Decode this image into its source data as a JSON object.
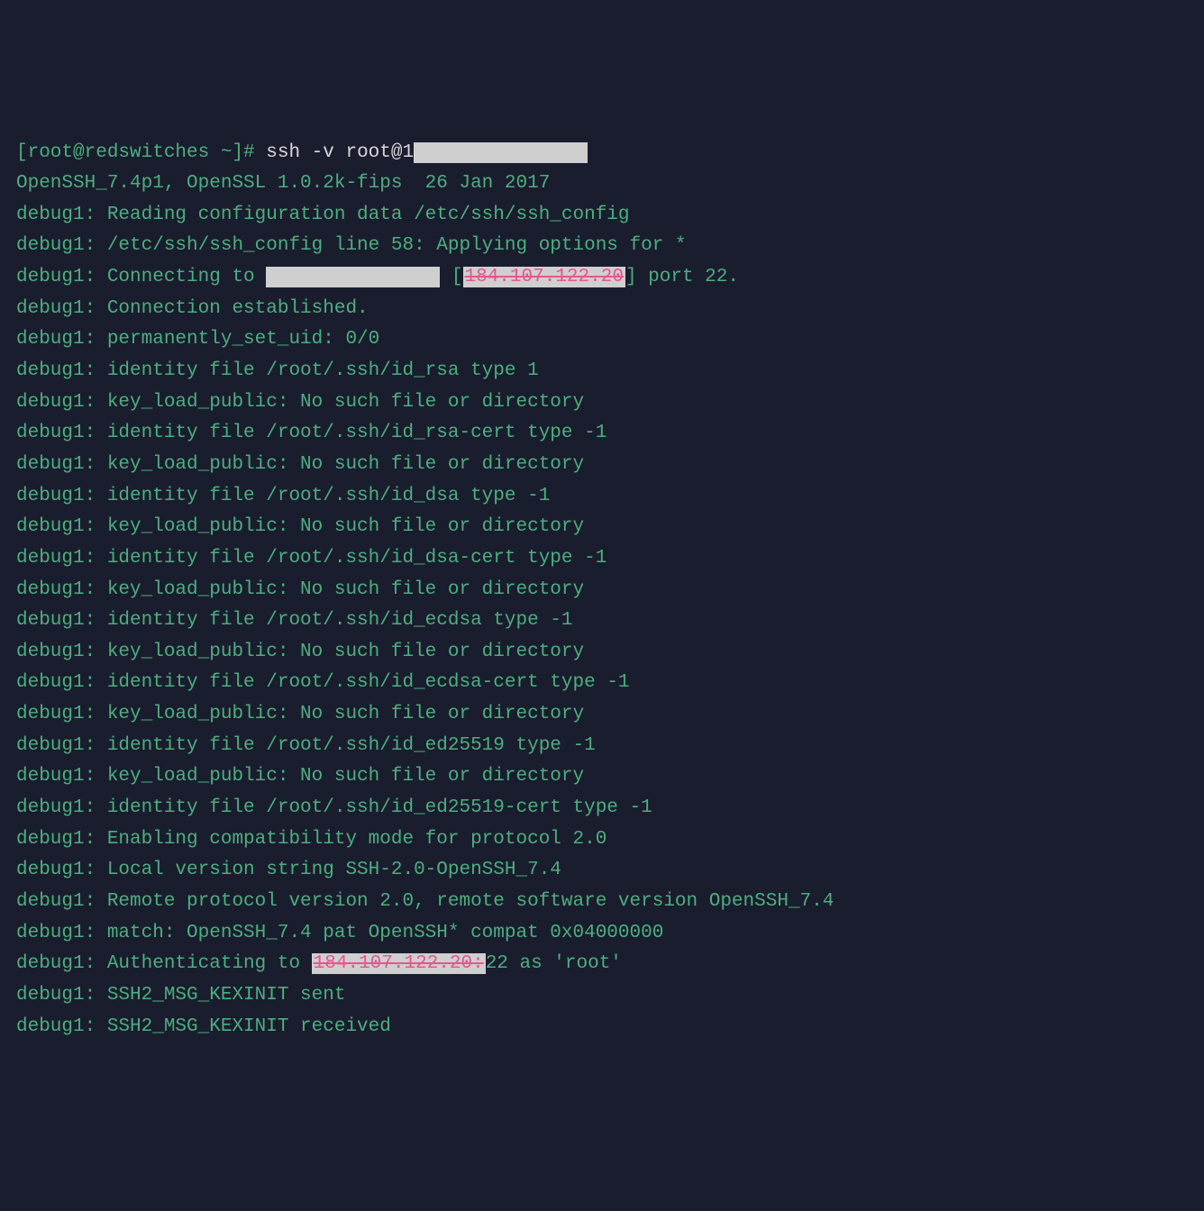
{
  "colors": {
    "background": "#1a1d2e",
    "green": "#4caf7f",
    "white": "#d8d8d8",
    "pink": "#e6568f",
    "redact": "#cfcfcf"
  },
  "prompt": {
    "user": "root",
    "host": "redswitches",
    "path": "~",
    "symbol": "#"
  },
  "command": "ssh -v root@1",
  "redacted_ip_visible": "184.107.122.20",
  "lines": {
    "l01_prompt_open": "[root@redswitches ~]# ",
    "l01_cmd": "ssh -v root@1",
    "l02": "OpenSSH_7.4p1, OpenSSL 1.0.2k-fips  26 Jan 2017",
    "l03": "debug1: Reading configuration data /etc/ssh/ssh_config",
    "l04": "debug1: /etc/ssh/ssh_config line 58: Applying options for *",
    "l05a": "debug1: Connecting to ",
    "l05b": " [",
    "l05_ip": "184.107.122.20",
    "l05c": "] port 22.",
    "l06": "debug1: Connection established.",
    "l07": "debug1: permanently_set_uid: 0/0",
    "l08": "debug1: identity file /root/.ssh/id_rsa type 1",
    "l09": "debug1: key_load_public: No such file or directory",
    "l10": "debug1: identity file /root/.ssh/id_rsa-cert type -1",
    "l11": "debug1: key_load_public: No such file or directory",
    "l12": "debug1: identity file /root/.ssh/id_dsa type -1",
    "l13": "debug1: key_load_public: No such file or directory",
    "l14": "debug1: identity file /root/.ssh/id_dsa-cert type -1",
    "l15": "debug1: key_load_public: No such file or directory",
    "l16": "debug1: identity file /root/.ssh/id_ecdsa type -1",
    "l17": "debug1: key_load_public: No such file or directory",
    "l18": "debug1: identity file /root/.ssh/id_ecdsa-cert type -1",
    "l19": "debug1: key_load_public: No such file or directory",
    "l20": "debug1: identity file /root/.ssh/id_ed25519 type -1",
    "l21": "debug1: key_load_public: No such file or directory",
    "l22": "debug1: identity file /root/.ssh/id_ed25519-cert type -1",
    "l23": "debug1: Enabling compatibility mode for protocol 2.0",
    "l24": "debug1: Local version string SSH-2.0-OpenSSH_7.4",
    "l25": "debug1: Remote protocol version 2.0, remote software version OpenSSH_7.4",
    "l26": "debug1: match: OpenSSH_7.4 pat OpenSSH* compat 0x04000000",
    "l27a": "debug1: Authenticating to ",
    "l27_ip": "184.107.122.20:",
    "l27b": "22 as 'root'",
    "l28": "debug1: SSH2_MSG_KEXINIT sent",
    "l29": "debug1: SSH2_MSG_KEXINIT received",
    "redact_block": "               "
  }
}
